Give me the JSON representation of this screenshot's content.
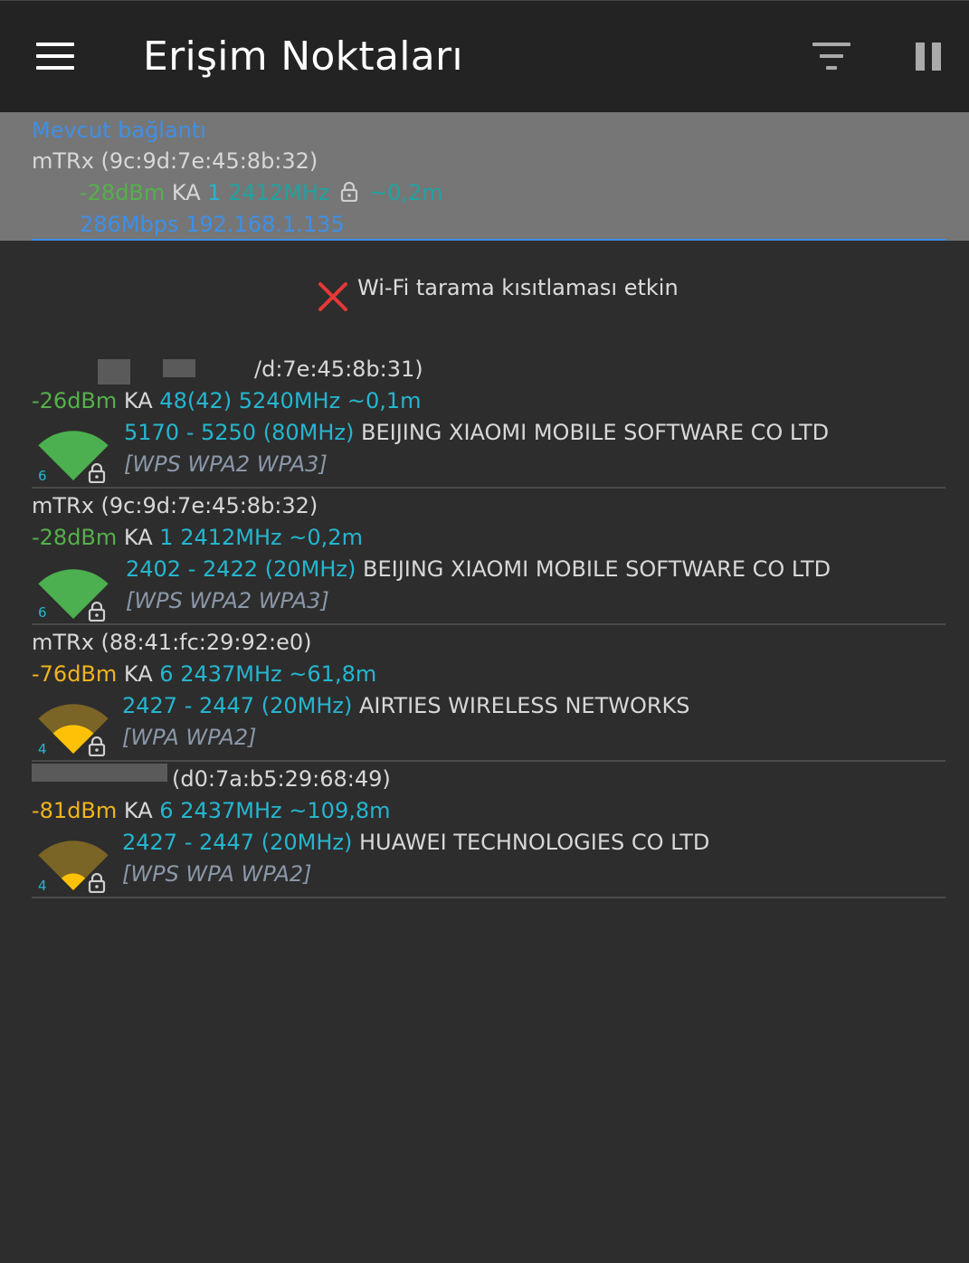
{
  "app": {
    "title": "Erişim Noktaları"
  },
  "current_connection": {
    "header": "Mevcut bağlantı",
    "name_line": "mTRx (9c:9d:7e:45:8b:32)",
    "signal": "-28dBm",
    "ka_label": "KA",
    "channel": "1",
    "frequency": "2412MHz",
    "distance": "~0,2m",
    "speed_ip": "286Mbps 192.168.1.135"
  },
  "notice": {
    "text": "Wi-Fi tarama kısıtlaması etkin"
  },
  "colors": {
    "strong_signal": "#55b04b",
    "weak_signal": "#f0b41d",
    "channel": "#25b6cf",
    "link": "#3f8fe6",
    "error": "#e53935"
  },
  "access_points": [
    {
      "name_line": "/d:7e:45:8b:31)",
      "signal": "-26dBm",
      "ka_label": "KA",
      "channel": "48(42)",
      "frequency": "5240MHz",
      "distance": "~0,1m",
      "range": "5170 - 5250",
      "width": "(80MHz)",
      "vendor": "BEIJING XIAOMI MOBILE SOFTWARE CO LTD",
      "security": "[WPS WPA2 WPA3]",
      "wifi_standard": "6",
      "level": "strong"
    },
    {
      "name_line": "mTRx (9c:9d:7e:45:8b:32)",
      "signal": "-28dBm",
      "ka_label": "KA",
      "channel": "1",
      "frequency": "2412MHz",
      "distance": "~0,2m",
      "range": "2402 - 2422",
      "width": "(20MHz)",
      "vendor": "BEIJING XIAOMI MOBILE SOFTWARE CO LTD",
      "security": "[WPS WPA2 WPA3]",
      "wifi_standard": "6",
      "level": "strong"
    },
    {
      "name_line": "mTRx (88:41:fc:29:92:e0)",
      "signal": "-76dBm",
      "ka_label": "KA",
      "channel": "6",
      "frequency": "2437MHz",
      "distance": "~61,8m",
      "range": "2427 - 2447",
      "width": "(20MHz)",
      "vendor": "AIRTIES WIRELESS NETWORKS",
      "security": "[WPA WPA2]",
      "wifi_standard": "4",
      "level": "medium"
    },
    {
      "name_line": "(d0:7a:b5:29:68:49)",
      "signal": "-81dBm",
      "ka_label": "KA",
      "channel": "6",
      "frequency": "2437MHz",
      "distance": "~109,8m",
      "range": "2427 - 2447",
      "width": "(20MHz)",
      "vendor": "HUAWEI TECHNOLOGIES CO LTD",
      "security": "[WPS WPA WPA2]",
      "wifi_standard": "4",
      "level": "weak"
    }
  ]
}
